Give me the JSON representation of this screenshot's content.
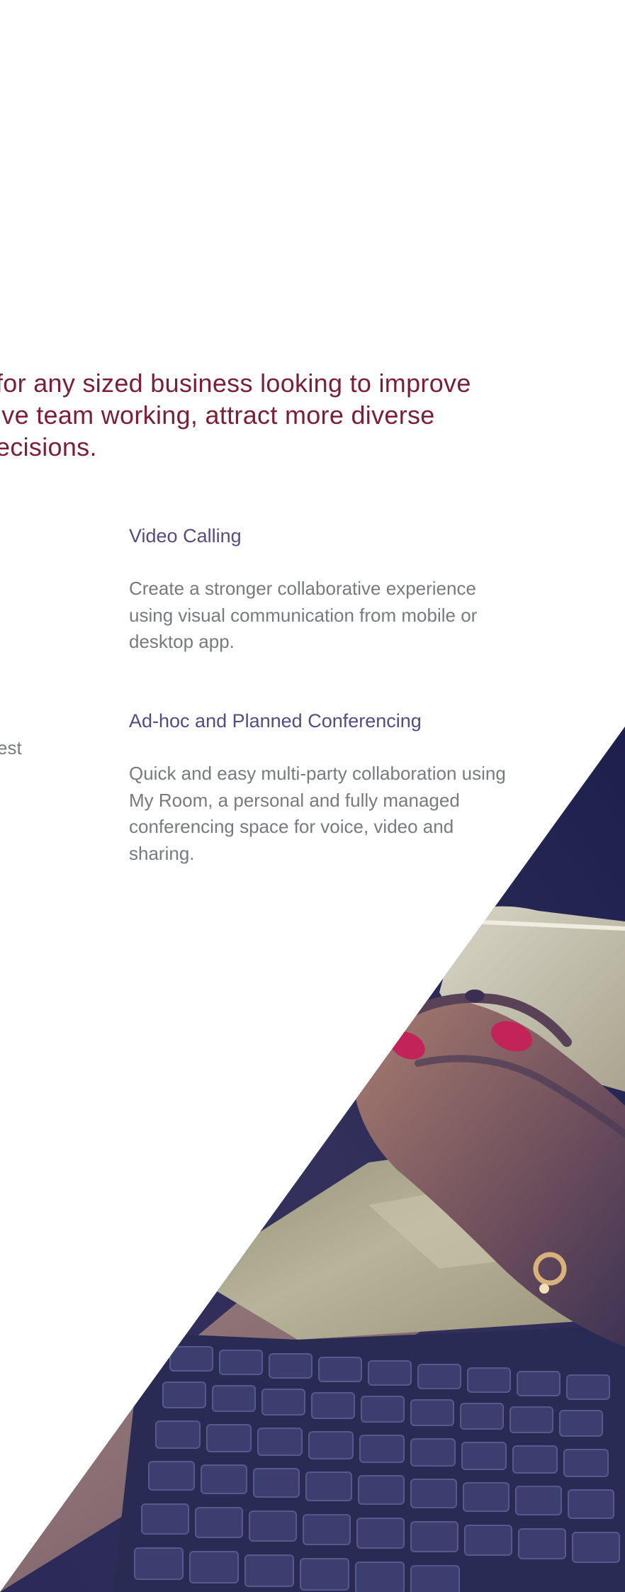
{
  "intro": {
    "lines": [
      "for any sized business looking to improve",
      "ive team working, attract more diverse",
      "ecisions."
    ]
  },
  "features": [
    {
      "title": "Video Calling",
      "lines": [
        "Create a stronger collaborative experience",
        "using visual communication from mobile or",
        "desktop app."
      ]
    },
    {
      "title": "Ad-hoc and Planned Conferencing",
      "lines": [
        "Quick and easy multi-party collaboration using",
        "My Room, a personal and fully managed",
        "conferencing space for voice, video and",
        "sharing."
      ]
    }
  ],
  "fragment": "est",
  "colors": {
    "intro_text": "#7a1f35",
    "heading": "#574b80",
    "body_text": "#777a80",
    "photo_edge": "#1e2150"
  }
}
